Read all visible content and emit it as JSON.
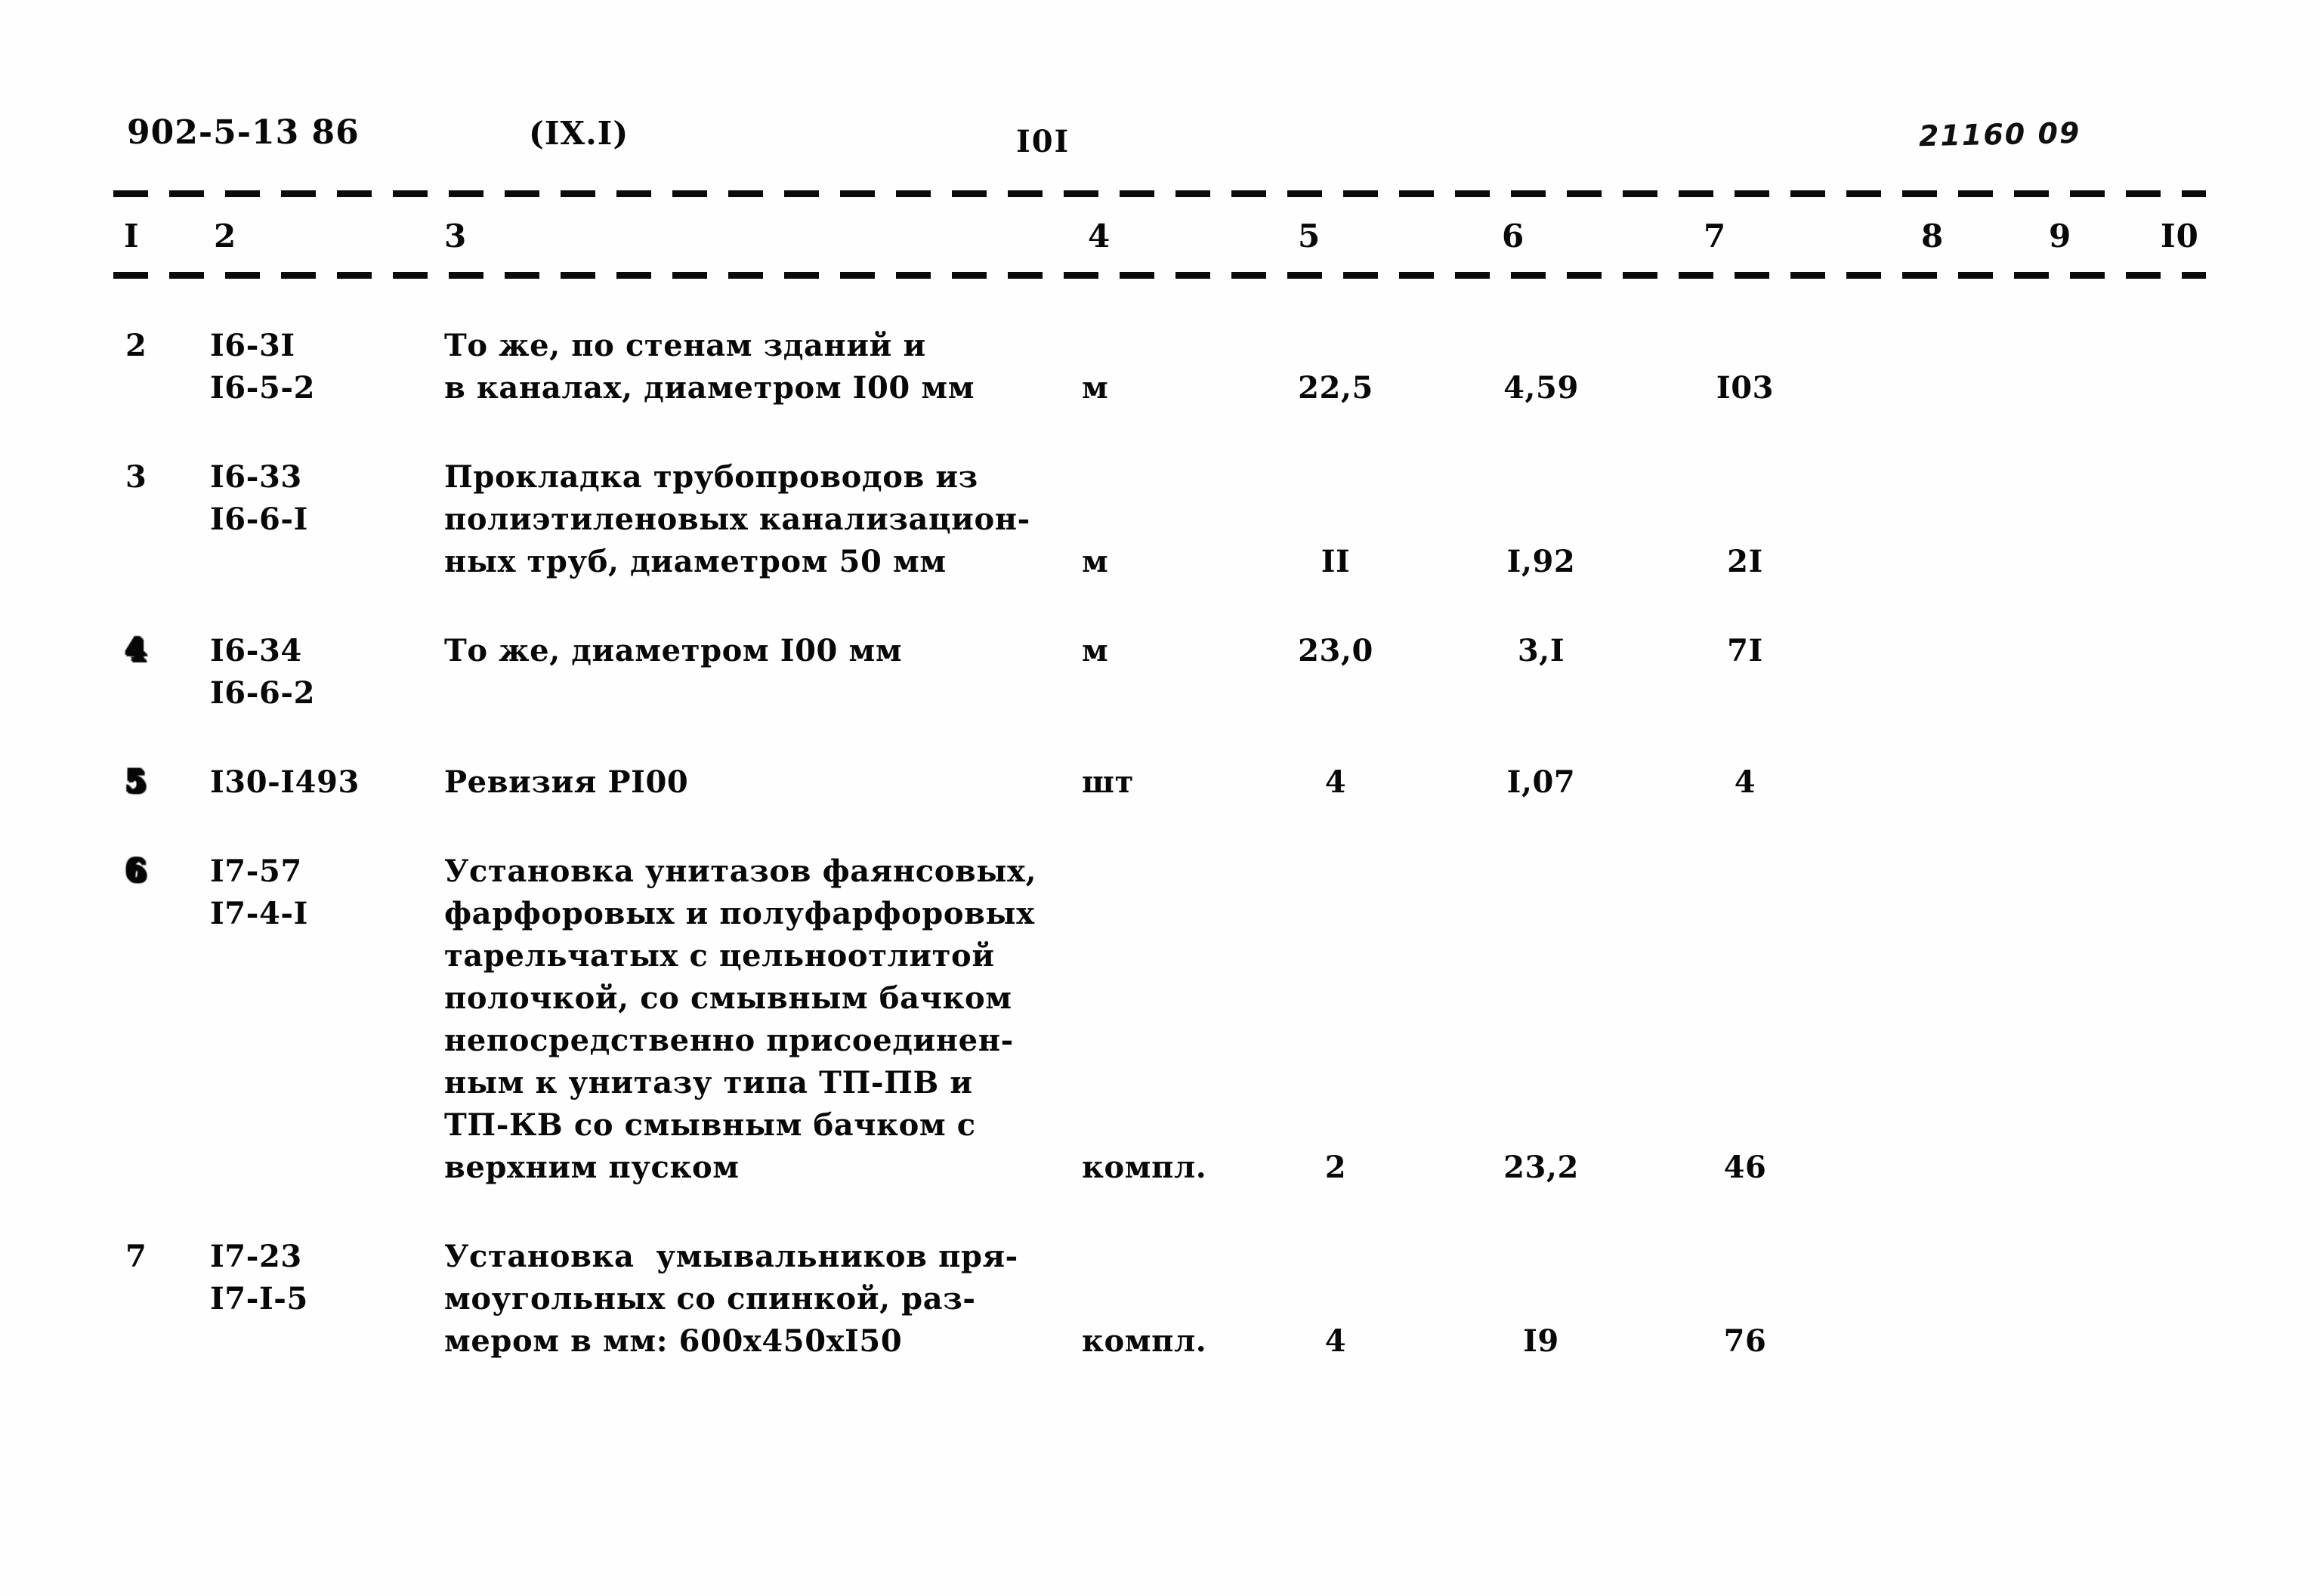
{
  "header": {
    "doc_code": "902-5-13 86",
    "section": "(IX.I)",
    "page_number": "I0I",
    "hand_note": "21160 09"
  },
  "table": {
    "column_headers": [
      "I",
      "2",
      "3",
      "4",
      "5",
      "6",
      "7",
      "8",
      "9",
      "I0"
    ],
    "rows": [
      {
        "num": "2",
        "code": "I6-3I\nI6-5-2",
        "description": "То же, по стенам зданий и\nв каналах, диаметром I00 мм",
        "unit": "м",
        "col5": "22,5",
        "col6": "4,59",
        "col7": "I03",
        "col8": "",
        "col9": "",
        "col10": ""
      },
      {
        "num": "3",
        "code": "I6-33\nI6-6-I",
        "description": "Прокладка трубопроводов из\nполиэтиленовых канализацион-\nных труб, диаметром 50 мм",
        "unit": "м",
        "col5": "II",
        "col6": "I,92",
        "col7": "2I",
        "col8": "",
        "col9": "",
        "col10": ""
      },
      {
        "num": "4",
        "code": "I6-34\nI6-6-2",
        "description": "То же, диаметром I00 мм",
        "unit": "м",
        "col5": "23,0",
        "col6": "3,I",
        "col7": "7I",
        "col8": "",
        "col9": "",
        "col10": ""
      },
      {
        "num": "5",
        "code": "I30-I493",
        "description": "Ревизия РI00",
        "unit": "шт",
        "col5": "4",
        "col6": "I,07",
        "col7": "4",
        "col8": "",
        "col9": "",
        "col10": ""
      },
      {
        "num": "6",
        "code": "I7-57\nI7-4-I",
        "description": "Установка унитазов фаянсовых,\nфарфоровых и полуфарфоровых\nтарельчатых с цельноотлитой\nполочкой, со смывным бачком\nнепосредственно присоединен-\nным к унитазу типа ТП-ПВ и\nТП-КВ со смывным бачком с\nверхним пуском",
        "unit": "компл.",
        "col5": "2",
        "col6": "23,2",
        "col7": "46",
        "col8": "",
        "col9": "",
        "col10": ""
      },
      {
        "num": "7",
        "code": "I7-23\nI7-I-5",
        "description": "Установка  умывальников пря-\nмоугольных со спинкой, раз-\nмером в мм: 600x450xI50",
        "unit": "компл.",
        "col5": "4",
        "col6": "I9",
        "col7": "76",
        "col8": "",
        "col9": "",
        "col10": ""
      }
    ]
  }
}
